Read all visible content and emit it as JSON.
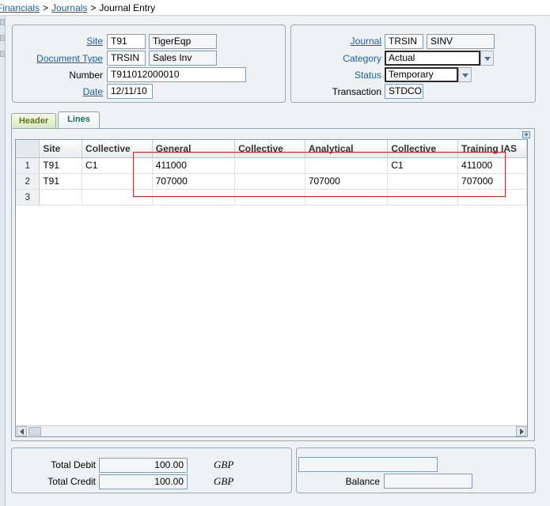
{
  "breadcrumb": {
    "items": [
      "Financials",
      "Journals",
      "Journal Entry"
    ],
    "separator": ">"
  },
  "header_left": {
    "site_label": "Site",
    "site_code": "T91",
    "site_name": "TigerEqp",
    "doctype_label": "Document Type",
    "doctype_code": "TRSIN",
    "doctype_name": "Sales Inv",
    "number_label": "Number",
    "number_value": "T911012000010",
    "date_label": "Date",
    "date_value": "12/11/10"
  },
  "header_right": {
    "journal_label": "Journal",
    "journal_code": "TRSIN",
    "journal_name": "SINV",
    "category_label": "Category",
    "category_value": "Actual",
    "status_label": "Status",
    "status_value": "Temporary",
    "transaction_label": "Transaction",
    "transaction_value": "STDCO"
  },
  "tabs": [
    {
      "label": "Header"
    },
    {
      "label": "Lines"
    }
  ],
  "grid": {
    "columns": [
      "Site",
      "Collective",
      "General",
      "Collective",
      "Analytical",
      "Collective",
      "Training IAS"
    ],
    "rows": [
      {
        "num": "1",
        "cells": [
          "T91",
          "C1",
          "411000",
          "",
          "",
          "C1",
          "411000"
        ]
      },
      {
        "num": "2",
        "cells": [
          "T91",
          "",
          "707000",
          "",
          "707000",
          "",
          "707000"
        ]
      },
      {
        "num": "3",
        "cells": [
          "",
          "",
          "",
          "",
          "",
          "",
          ""
        ]
      }
    ]
  },
  "totals": {
    "debit_label": "Total Debit",
    "debit_value": "100.00",
    "debit_currency": "GBP",
    "credit_label": "Total Credit",
    "credit_value": "100.00",
    "credit_currency": "GBP",
    "balance_label": "Balance",
    "balance_value": "",
    "extra_value": ""
  },
  "colors": {
    "link": "#1a5fb4",
    "highlight_box": "#cc2b2b",
    "header_tab": "#5b7a1e",
    "lines_tab": "#1c6b63"
  }
}
